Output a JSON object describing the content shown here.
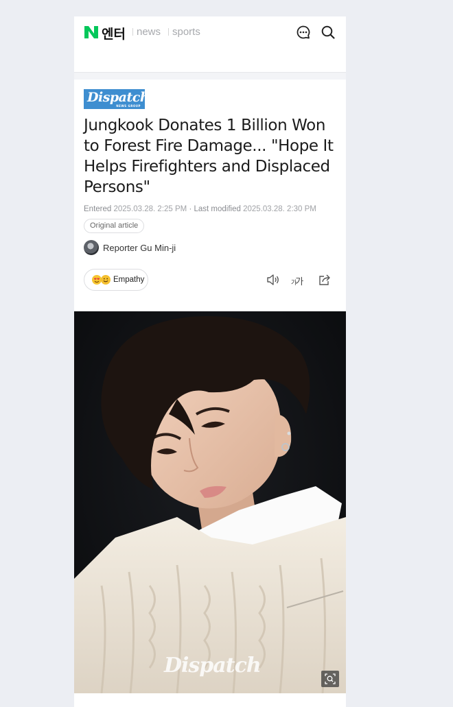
{
  "header": {
    "brand_letter": "N",
    "section": "엔터",
    "nav": [
      {
        "label": "news"
      },
      {
        "label": "sports"
      }
    ]
  },
  "article": {
    "press": {
      "name": "Dispatch",
      "sub": "NEWS GROUP"
    },
    "headline": "Jungkook Donates 1 Billion Won to Forest Fire Damage... \"Hope It Helps Firefighters and Displaced Persons\"",
    "meta": {
      "entered_label": "Entered",
      "entered_date": "2025.03.28. 2:25 PM",
      "modified_label": "Last modified",
      "modified_date": "2025.03.28. 2:30 PM"
    },
    "original_label": "Original article",
    "reporter": "Reporter Gu Min-ji",
    "empathy_label": "Empathy",
    "font_size_label": "가가",
    "photo_watermark": "Dispatch"
  },
  "colors": {
    "brand_green": "#03c75a",
    "press_blue": "#3e8ed0"
  }
}
